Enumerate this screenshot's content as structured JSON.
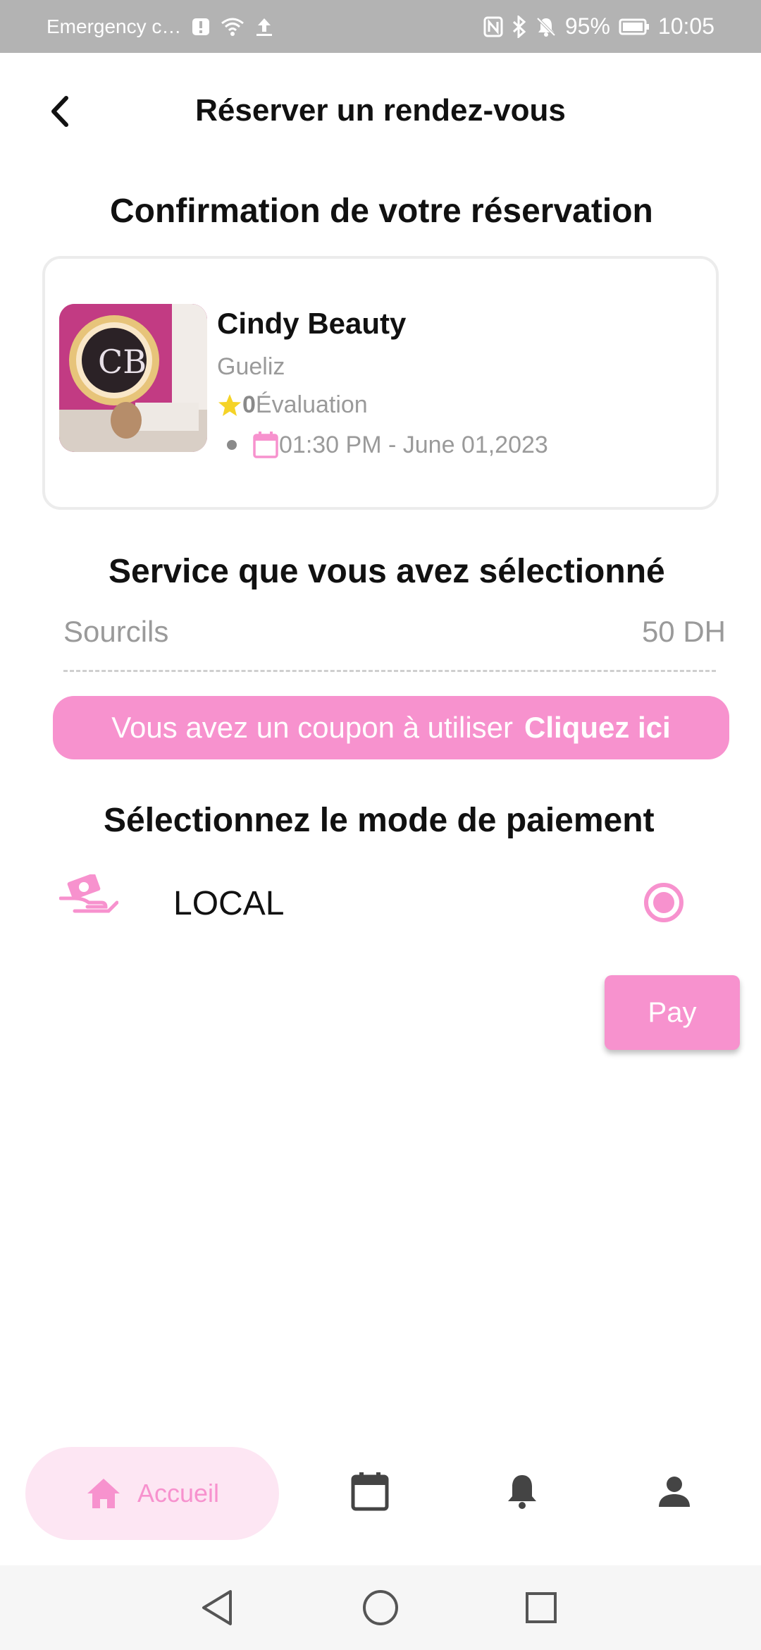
{
  "status_bar": {
    "carrier": "Emergency c…",
    "battery": "95%",
    "time": "10:05"
  },
  "header": {
    "title": "Réserver un rendez-vous"
  },
  "confirmation": {
    "title": "Confirmation de votre réservation"
  },
  "salon": {
    "name": "Cindy Beauty",
    "area": "Gueliz",
    "rating_value": "0",
    "rating_label": "Évaluation",
    "datetime": "01:30 PM - June 01,2023"
  },
  "service": {
    "title": "Service que vous avez sélectionné",
    "name": "Sourcils",
    "price": "50 DH"
  },
  "coupon": {
    "text": "Vous avez un coupon à utiliser",
    "link": "Cliquez ici"
  },
  "payment": {
    "title": "Sélectionnez le mode de paiement",
    "method": "LOCAL",
    "selected": true
  },
  "pay_button": {
    "label": "Pay"
  },
  "bottom_nav": {
    "home_label": "Accueil",
    "active": "home"
  },
  "colors": {
    "accent": "#f792ce",
    "accent_light": "#fde6f3",
    "muted_text": "#9a9a9a",
    "star": "#f5d327"
  },
  "icons": [
    "back-arrow-icon",
    "star-icon",
    "calendar-icon",
    "cash-hand-icon",
    "home-icon",
    "bell-icon",
    "person-icon"
  ]
}
